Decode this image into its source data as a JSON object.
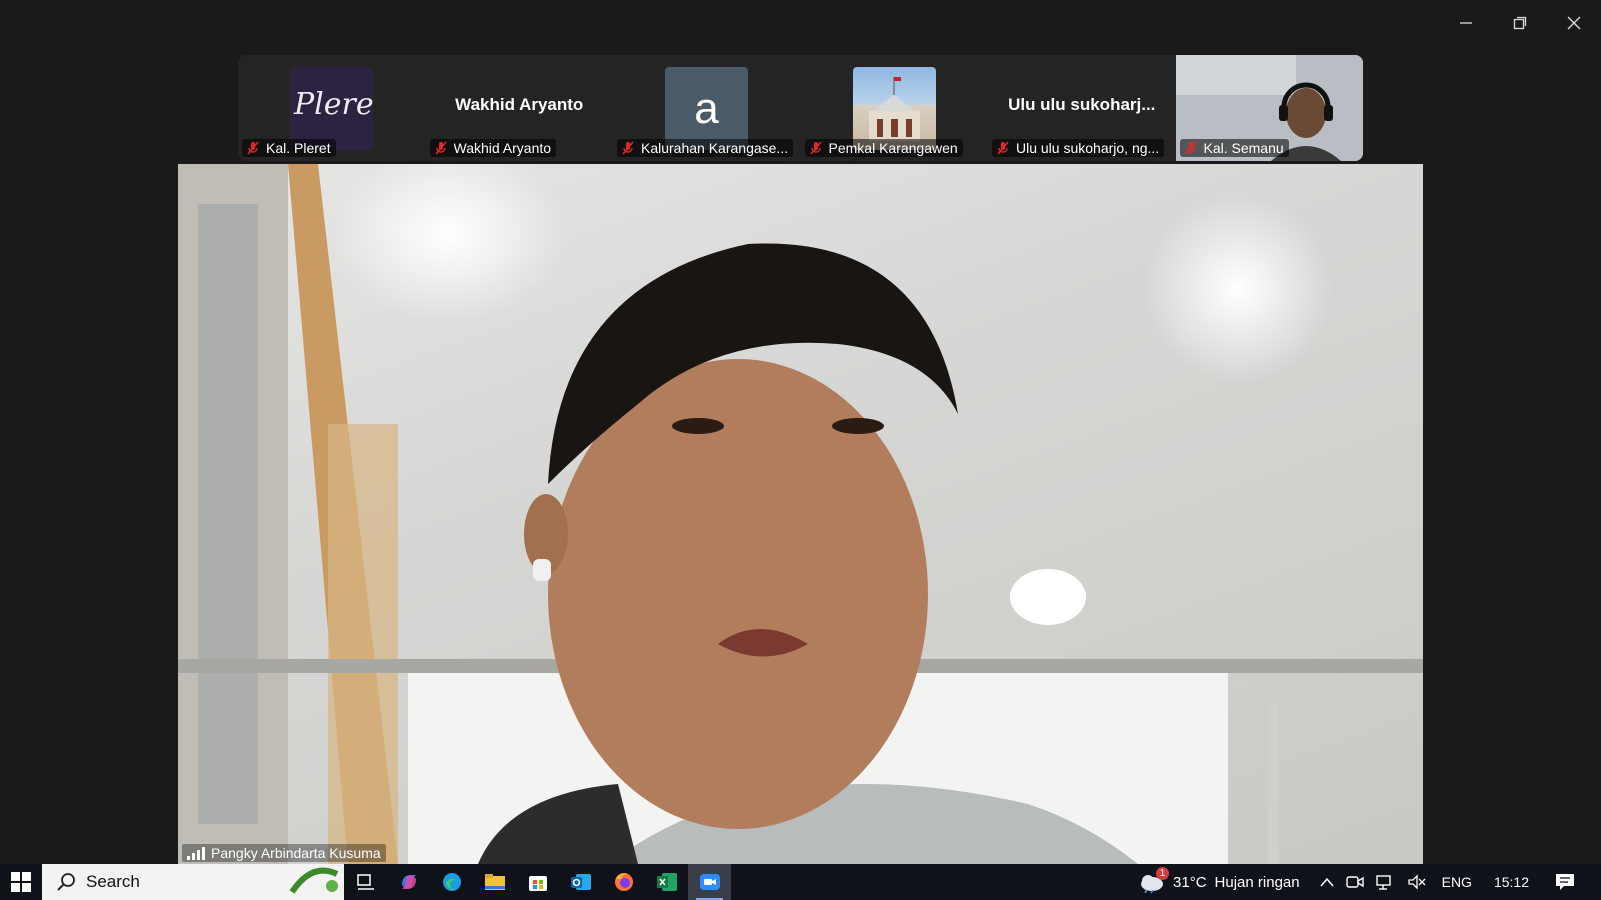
{
  "participants": [
    {
      "name": "Kal. Pleret",
      "avatar_text": "Pleret",
      "type": "logo"
    },
    {
      "name": "Wakhid Aryanto",
      "display_title": "Wakhid Aryanto",
      "type": "text"
    },
    {
      "name": "Kalurahan Karangase...",
      "avatar_text": "a",
      "type": "letter"
    },
    {
      "name": "Pemkal Karangawen",
      "type": "image"
    },
    {
      "name": "Ulu ulu sukoharjo, ng...",
      "display_title": "Ulu ulu sukoharj...",
      "type": "text"
    },
    {
      "name": "Kal. Semanu",
      "type": "video"
    }
  ],
  "active_speaker": {
    "name": "Pangky Arbindarta Kusuma"
  },
  "taskbar": {
    "search_placeholder": "Search",
    "weather": {
      "temp": "31°C",
      "condition": "Hujan ringan",
      "badge": "1"
    },
    "language": "ENG",
    "time": "15:12",
    "apps": [
      "task-view-icon",
      "copilot-icon",
      "edge-icon",
      "file-explorer-icon",
      "store-icon",
      "outlook-icon",
      "firefox-icon",
      "excel-icon",
      "zoom-icon"
    ]
  },
  "colors": {
    "mute": "#e02828",
    "accent": "#7aa7ff",
    "background": "#1a1a1a"
  }
}
